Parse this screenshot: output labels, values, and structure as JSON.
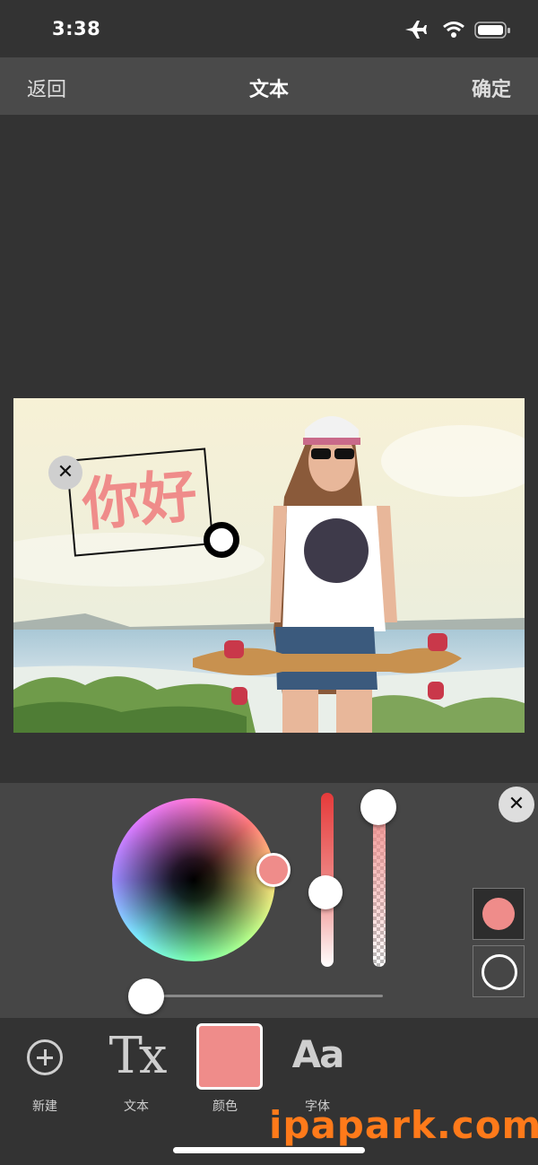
{
  "status_bar": {
    "time": "3:38",
    "icons": [
      "airplane-icon",
      "wifi-icon",
      "battery-icon"
    ]
  },
  "nav": {
    "back_label": "返回",
    "title": "文本",
    "confirm_label": "确定"
  },
  "canvas": {
    "photo": "woman-with-skateboard-beach-photo",
    "sticker_text": "你好",
    "sticker_color": "#ef8c8a"
  },
  "color_panel": {
    "selected_color": "#ef8c8a",
    "brightness_level": 0.58,
    "opacity_level": 1.0,
    "size_level": 0.0,
    "fill_swatch_color": "#ef8c8a"
  },
  "toolbar": {
    "items": [
      {
        "label": "新建",
        "icon": "add-circle-icon"
      },
      {
        "label": "文本",
        "icon": "text-tx-icon",
        "glyph": "Tx"
      },
      {
        "label": "颜色",
        "icon": "color-swatch-icon"
      },
      {
        "label": "字体",
        "icon": "font-aa-icon",
        "glyph": "Aa"
      }
    ]
  },
  "watermark": "ipapark.com"
}
